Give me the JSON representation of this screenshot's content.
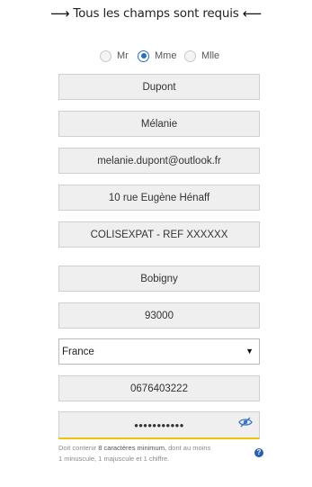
{
  "header": {
    "arrow_left": "⟶",
    "text": "Tous les champs sont requis",
    "arrow_right": "⟵"
  },
  "civility": {
    "options": [
      "Mr",
      "Mme",
      "Mlle"
    ],
    "selected": "Mme"
  },
  "form": {
    "last_name": "Dupont",
    "first_name": "Mélanie",
    "email": "melanie.dupont@outlook.fr",
    "address": "10 rue Eugène Hénaff",
    "address_complement": "COLISEXPAT - REF XXXXXX",
    "city": "Bobigny",
    "postal_code": "93000",
    "country": "France",
    "phone": "0676403222",
    "password_mask": "•••••••••••"
  },
  "password_hint": {
    "part1": "Doit contenir ",
    "part2": "8 caractères minimum,",
    "part3": " dont au moins",
    "line2": "1 minuscule, 1 majuscule et 1 chiffre."
  },
  "help_icon_glyph": "?",
  "colors": {
    "accent_blue": "#2a6fc0",
    "password_underline": "#f0c20a",
    "field_background": "#efefef"
  },
  "icons": {
    "password_toggle": "eye-slash-icon",
    "help": "question-circle-icon",
    "select_caret": "caret-down-icon"
  }
}
